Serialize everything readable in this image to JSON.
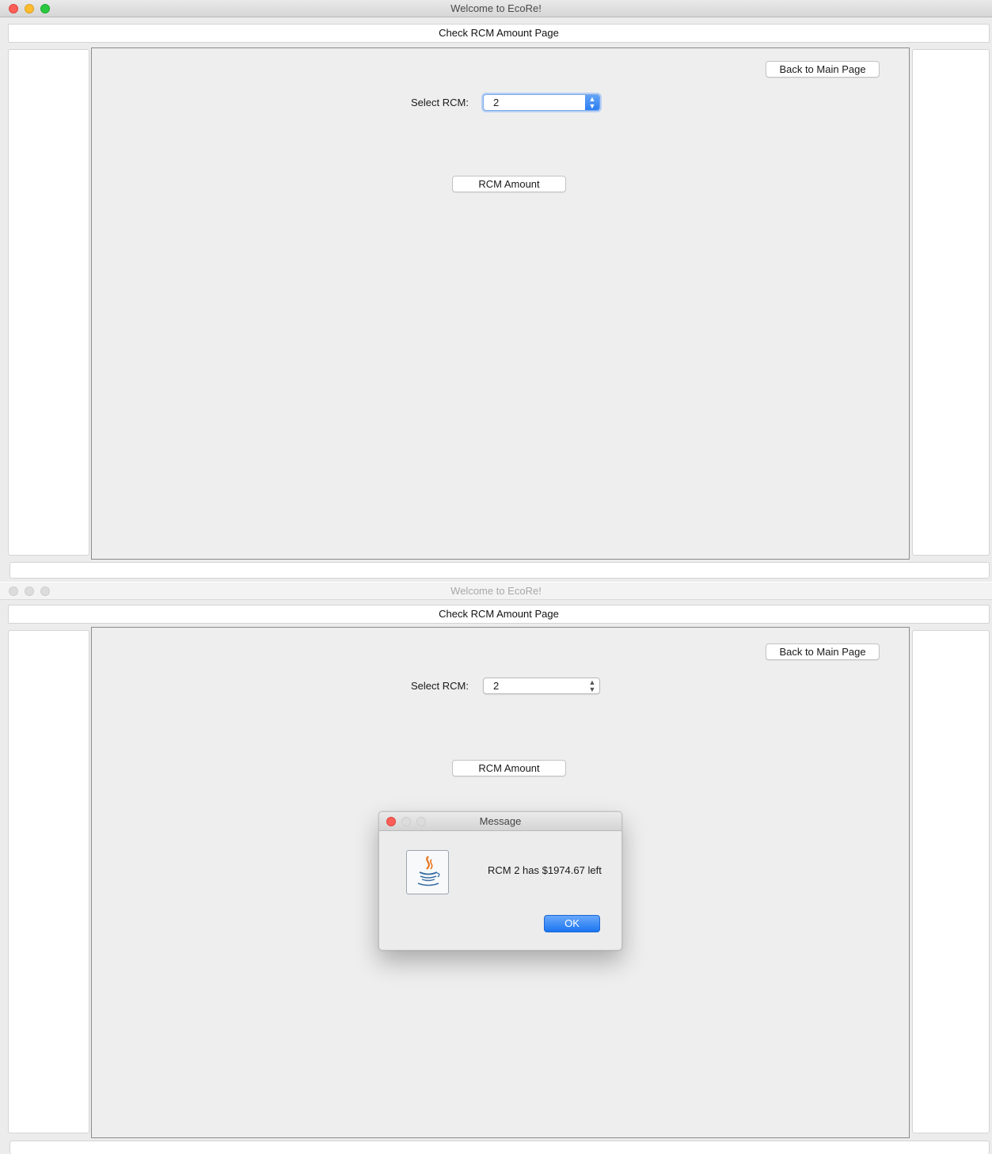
{
  "window": {
    "title": "Welcome to EcoRe!",
    "header": "Check RCM Amount Page",
    "back_label": "Back to Main Page",
    "select_label": "Select RCM:",
    "select_value": "2",
    "amount_label": "RCM Amount"
  },
  "dialog": {
    "title": "Message",
    "message": "RCM 2 has $1974.67 left",
    "ok_label": "OK",
    "icon": "java-cup-icon"
  },
  "colors": {
    "close": "#fc5f57",
    "minimize": "#fdbc2e",
    "zoom": "#29c840",
    "accent": "#2c7ef2"
  }
}
